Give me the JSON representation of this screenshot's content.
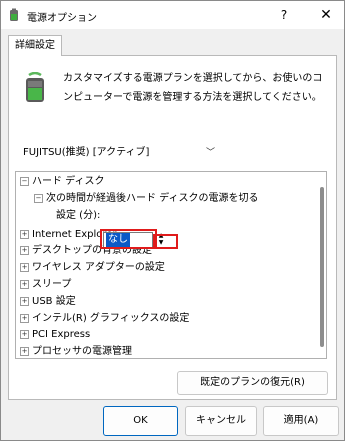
{
  "window": {
    "title": "電源オプション",
    "help_label": "?",
    "close_label": "✕"
  },
  "tab": {
    "label": "詳細設定"
  },
  "description": "カスタマイズする電源プランを選択してから、お使いのコンピューターで電源を管理する方法を選択してください。",
  "plan_select": {
    "value": "FUJITSU(推奨) [アクティブ]"
  },
  "tree": {
    "items": [
      {
        "label": "ハード ディスク",
        "expander": "⊟"
      },
      {
        "label": "次の時間が経過後ハード ディスクの電源を切る",
        "expander": "⊟"
      },
      {
        "label": "設定 (分):"
      },
      {
        "label": "Internet Explorer",
        "expander": "⊞"
      },
      {
        "label": "デスクトップの背景の設定",
        "expander": "⊞"
      },
      {
        "label": "ワイヤレス アダプターの設定",
        "expander": "⊞"
      },
      {
        "label": "スリープ",
        "expander": "⊞"
      },
      {
        "label": "USB 設定",
        "expander": "⊞"
      },
      {
        "label": "インテル(R) グラフィックスの設定",
        "expander": "⊞"
      },
      {
        "label": "PCI Express",
        "expander": "⊞"
      },
      {
        "label": "プロセッサの電源管理",
        "expander": "⊞"
      }
    ],
    "setting_value": "なし"
  },
  "buttons": {
    "restore": "既定のプランの復元(R)",
    "ok": "OK",
    "cancel": "キャンセル",
    "apply": "適用(A)"
  },
  "colors": {
    "accent": "#0067c0",
    "selection": "#0b59c7",
    "highlight": "#e01b1b"
  }
}
